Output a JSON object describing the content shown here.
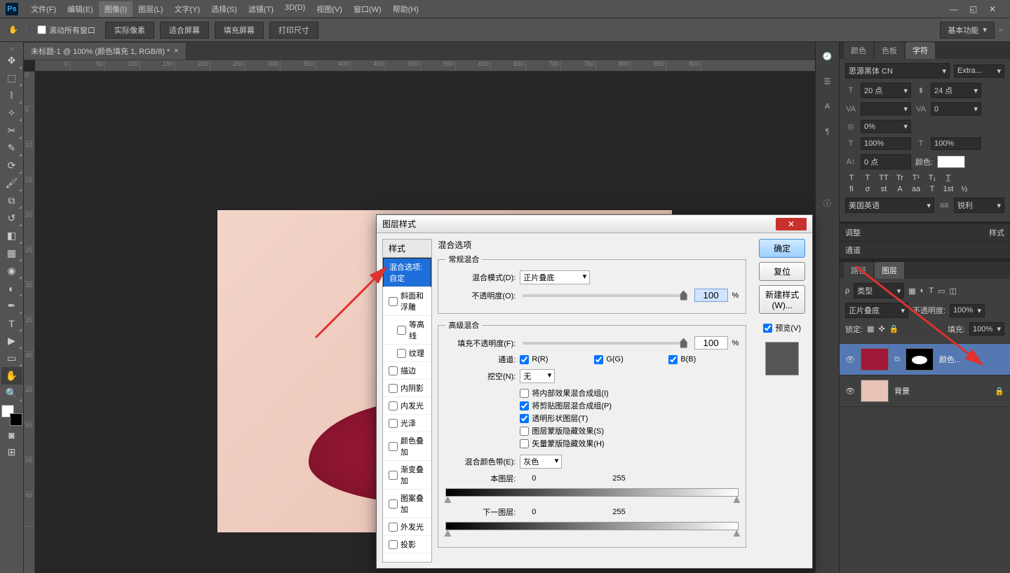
{
  "menubar": [
    "文件(F)",
    "编辑(E)",
    "图像(I)",
    "图层(L)",
    "文字(Y)",
    "选择(S)",
    "滤镜(T)",
    "3D(D)",
    "视图(V)",
    "窗口(W)",
    "帮助(H)"
  ],
  "menu_active_index": 2,
  "optbar": {
    "scroll_all": "滚动所有窗口",
    "btns": [
      "实际像素",
      "适合屏幕",
      "填充屏幕",
      "打印尺寸"
    ],
    "workspace": "基本功能"
  },
  "doc_tab": "未标题-1 @ 100% (颜色填充 1, RGB/8) *",
  "ruler_h": [
    "0",
    "50",
    "100",
    "150",
    "200",
    "250",
    "300",
    "350",
    "400",
    "450",
    "500",
    "550",
    "600",
    "650",
    "700",
    "750",
    "800",
    "850",
    "900"
  ],
  "ruler_v": [
    "0",
    "5",
    "10",
    "15",
    "20",
    "25",
    "30",
    "35",
    "40",
    "45",
    "50",
    "55",
    "60"
  ],
  "char_panel": {
    "tabs": [
      "颜色",
      "色板",
      "字符"
    ],
    "active_tab": 2,
    "font": "思源黑体 CN",
    "weight": "Extra...",
    "size": "20 点",
    "leading": "24 点",
    "tracking": "0",
    "va": "VA",
    "scale_v": "100%",
    "scale_h": "100%",
    "baseline": "0 点",
    "color_label": "颜色:",
    "opacity_pct": "0%",
    "lang": "美国英语",
    "aa_label": "aa",
    "aa": "锐利",
    "style_row1": [
      "T",
      "T",
      "TT",
      "Tr",
      "T¹",
      "T₁",
      "T̲"
    ],
    "style_row2": [
      "fi",
      "σ",
      "st",
      "A",
      "aa",
      "T",
      "1st",
      "½"
    ]
  },
  "adj": {
    "tabs": [
      "调整",
      "样式"
    ],
    "channel": "通道"
  },
  "layers_panel": {
    "tabs": [
      "路径",
      "图层"
    ],
    "active_tab": 1,
    "kind_label": "类型",
    "blend": "正片叠底",
    "opacity_label": "不透明度:",
    "opacity": "100%",
    "lock_label": "锁定:",
    "fill_label": "填充:",
    "fill": "100%",
    "layers": [
      {
        "name": "颜色...",
        "selected": true,
        "thumb_color": "#a11838",
        "mask": true
      },
      {
        "name": "背景",
        "selected": false,
        "thumb_color": "#e8c3b5",
        "locked": true
      }
    ]
  },
  "dialog": {
    "title": "图层样式",
    "left_header": "样式",
    "styles": [
      {
        "label": "混合选项:自定",
        "sel": true,
        "check": false
      },
      {
        "label": "斜面和浮雕",
        "check": true
      },
      {
        "label": "等高线",
        "check": true,
        "indent": true
      },
      {
        "label": "纹理",
        "check": true,
        "indent": true
      },
      {
        "label": "描边",
        "check": true
      },
      {
        "label": "内阴影",
        "check": true
      },
      {
        "label": "内发光",
        "check": true
      },
      {
        "label": "光泽",
        "check": true
      },
      {
        "label": "颜色叠加",
        "check": true
      },
      {
        "label": "渐变叠加",
        "check": true
      },
      {
        "label": "图案叠加",
        "check": true
      },
      {
        "label": "外发光",
        "check": true
      },
      {
        "label": "投影",
        "check": true
      }
    ],
    "section_title": "混合选项",
    "normal_header": "常规混合",
    "blend_label": "混合模式(D):",
    "blend_value": "正片叠底",
    "opacity_label": "不透明度(O):",
    "opacity_value": "100",
    "pct": "%",
    "adv_header": "高级混合",
    "fill_opacity_label": "填充不透明度(F):",
    "fill_opacity_value": "100",
    "channels_label": "通道:",
    "ch_r": "R(R)",
    "ch_g": "G(G)",
    "ch_b": "B(B)",
    "knockout_label": "挖空(N):",
    "knockout_value": "无",
    "adv_checks": [
      {
        "label": "将内部效果混合成组(I)",
        "checked": false
      },
      {
        "label": "将剪贴图层混合成组(P)",
        "checked": true
      },
      {
        "label": "透明形状图层(T)",
        "checked": true
      },
      {
        "label": "图层蒙版隐藏效果(S)",
        "checked": false
      },
      {
        "label": "矢量蒙版隐藏效果(H)",
        "checked": false
      }
    ],
    "blendif_label": "混合颜色带(E):",
    "blendif_value": "灰色",
    "this_layer": "本图层:",
    "under_layer": "下一图层:",
    "range_lo": "0",
    "range_hi": "255",
    "buttons": {
      "ok": "确定",
      "reset": "复位",
      "new": "新建样式(W)...",
      "preview": "预览(V)"
    }
  }
}
